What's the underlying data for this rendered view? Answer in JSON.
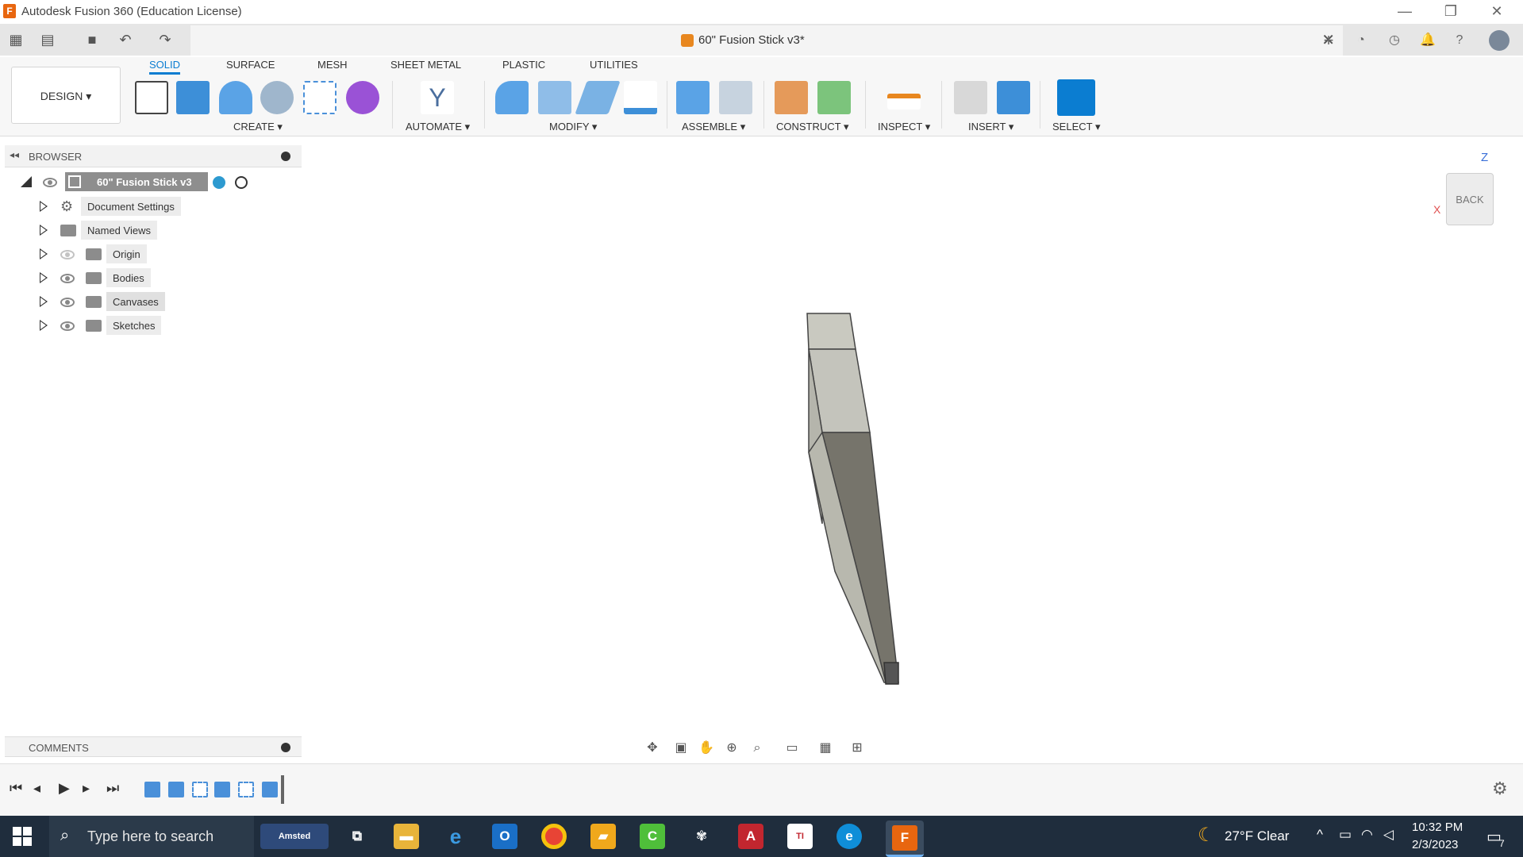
{
  "window": {
    "title": "Autodesk Fusion 360 (Education License)",
    "minimize": "—",
    "restore": "❐",
    "close": "✕"
  },
  "document": {
    "tab_name": "60\" Fusion Stick v3*",
    "close_label": "✕"
  },
  "ribbon": {
    "workspace": "DESIGN ▾",
    "tabs": [
      "SOLID",
      "SURFACE",
      "MESH",
      "SHEET METAL",
      "PLASTIC",
      "UTILITIES"
    ],
    "active_tab": "SOLID",
    "groups": [
      "CREATE ▾",
      "AUTOMATE ▾",
      "MODIFY ▾",
      "ASSEMBLE ▾",
      "CONSTRUCT ▾",
      "INSPECT ▾",
      "INSERT ▾",
      "SELECT ▾"
    ]
  },
  "browser": {
    "title": "BROWSER",
    "root": "60\" Fusion Stick v3",
    "items": [
      {
        "label": "Document Settings",
        "icon": "gear-icon"
      },
      {
        "label": "Named Views",
        "icon": "folder-icon"
      },
      {
        "label": "Origin",
        "icon": "folder-icon"
      },
      {
        "label": "Bodies",
        "icon": "folder-icon"
      },
      {
        "label": "Canvases",
        "icon": "folder-icon"
      },
      {
        "label": "Sketches",
        "icon": "folder-icon"
      }
    ]
  },
  "viewcube": {
    "face": "BACK",
    "axis_z": "Z",
    "axis_x": "X"
  },
  "comments": {
    "title": "COMMENTS"
  },
  "taskbar": {
    "search_placeholder": "Type here to search",
    "weather": "27°F  Clear",
    "time": "10:32 PM",
    "date": "2/3/2023",
    "notifications": "7",
    "apps": [
      "Amsted",
      "Task View",
      "File Explorer",
      "Internet Explorer",
      "Outlook",
      "Chrome",
      "Sticky",
      "Camtasia",
      "Fan",
      "Acrobat",
      "TI",
      "Edge",
      "Fusion 360"
    ]
  },
  "colors": {
    "accent": "#0b7dd1",
    "taskbar": "#1f2d3d",
    "fusion_orange": "#e8660f"
  }
}
